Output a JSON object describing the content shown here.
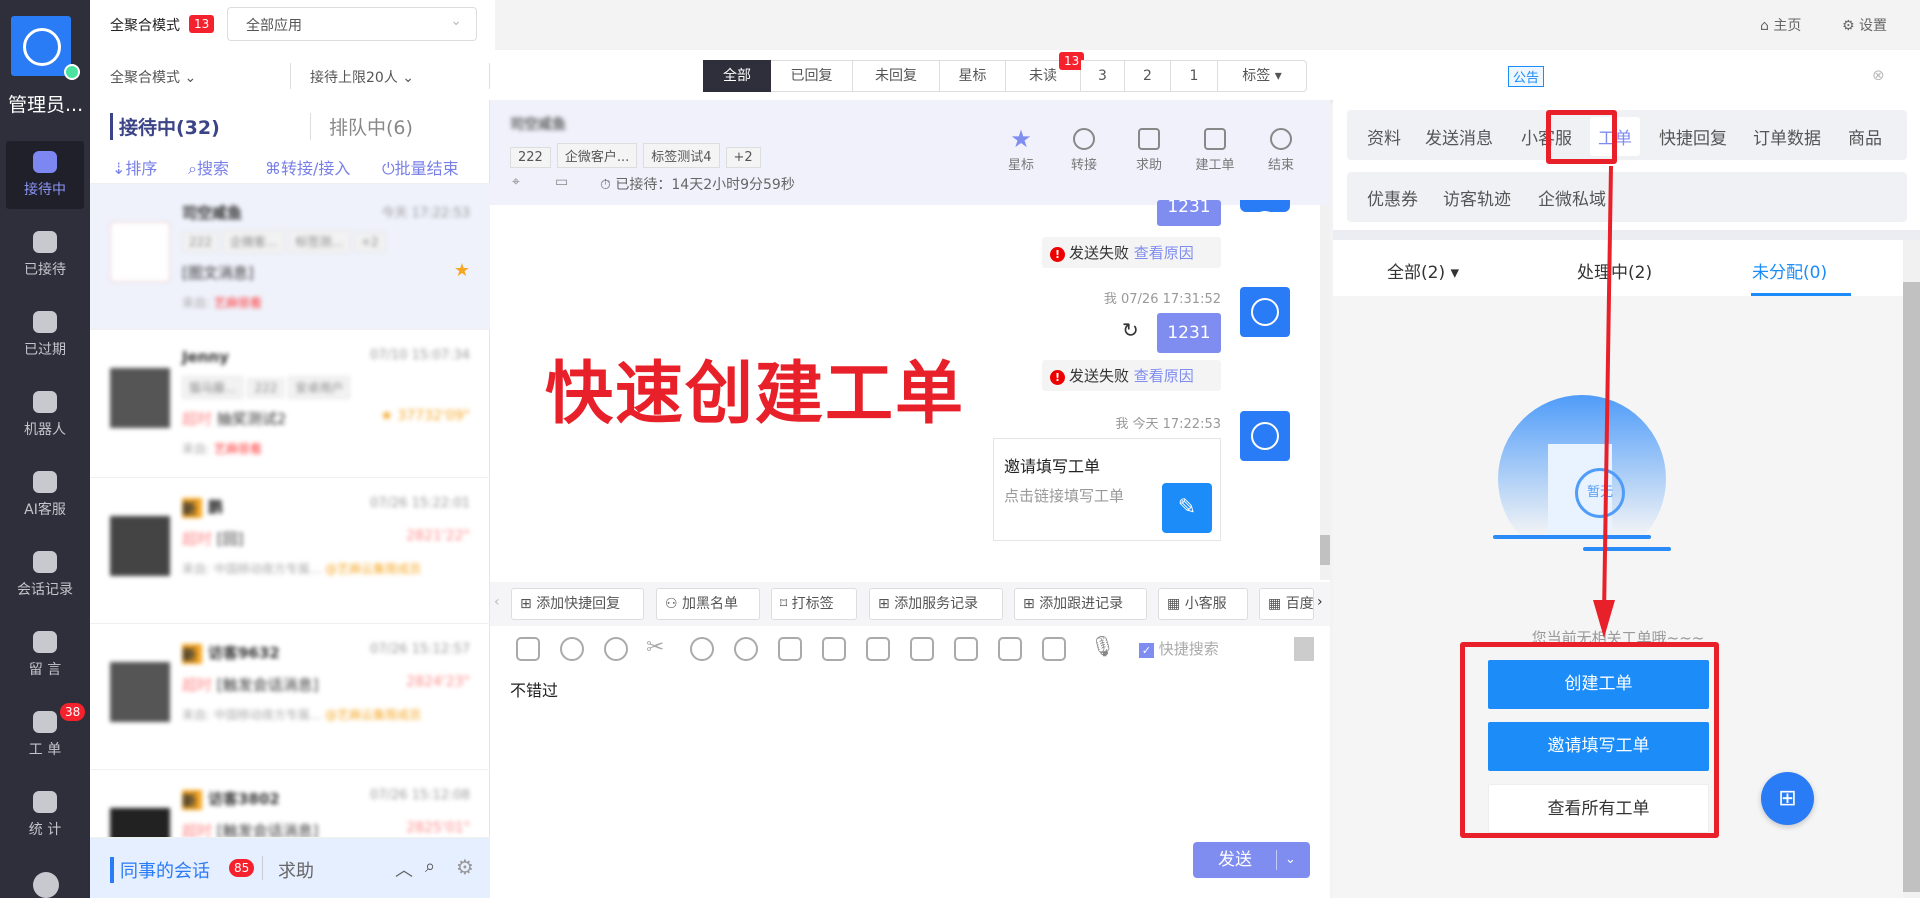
{
  "sidebar": {
    "admin": "管理员...",
    "items": [
      {
        "label": "接待中"
      },
      {
        "label": "已接待"
      },
      {
        "label": "已过期"
      },
      {
        "label": "机器人"
      },
      {
        "label": "AI客服"
      },
      {
        "label": "会话记录"
      },
      {
        "label": "留 言"
      },
      {
        "label": "工 单",
        "badge": "38"
      },
      {
        "label": "统 计"
      }
    ]
  },
  "topbar": {
    "mode": "全聚合模式",
    "mode_badge": "13",
    "app_select": "全部应用",
    "home": "主页",
    "settings": "设置"
  },
  "filterbar": {
    "mode_select": "全聚合模式",
    "limit_select": "接待上限20人",
    "tabs": [
      "全部",
      "已回复",
      "未回复",
      "星标",
      "未读",
      "3",
      "2",
      "1",
      "标签"
    ],
    "unread_badge": "13",
    "notice": "公告"
  },
  "list": {
    "tab_active": "接待中(32)",
    "tab_queue": "排队中(6)",
    "actions": [
      "排序",
      "搜索",
      "转接/接入",
      "批量结束"
    ],
    "items": [
      {
        "name": "司空咸鱼",
        "time": "今天 17:22:53",
        "tags": [
          "222",
          "企微客...",
          "标签测...",
          "+2"
        ],
        "msg": "[图文消息]",
        "from": "来自:",
        "source": "艺麻很看"
      },
      {
        "name": "Jenny",
        "time": "07/10 15:07:34",
        "tags": [
          "猫马藤...",
          "222",
          "安卓用户"
        ],
        "status": "超时",
        "msg": "抽奖测试2",
        "duration": "37732'09\"",
        "from": "来自:",
        "source": "艺麻很看"
      },
      {
        "name": "鹏",
        "new": "新",
        "time": "07/26 15:22:01",
        "status": "超时",
        "msg": "[回]",
        "duration": "2821'22\"",
        "from": "来自: 中国移动夜方专属...",
        "source": "@艺麻云集限成员"
      },
      {
        "name": "访客9632",
        "new": "新",
        "time": "07/26 15:12:57",
        "status": "超时",
        "msg": "[触发会话消息]",
        "duration": "2824'23\"",
        "from": "来自: 中国移动夜方专属...",
        "source": "@艺麻云集限成员"
      },
      {
        "name": "访客3802",
        "new": "新",
        "time": "07/26 15:12:08",
        "status": "超时",
        "msg": "[触发会话消息]",
        "duration": "2825'01\""
      }
    ],
    "bottom": {
      "colleague": "同事的会话",
      "colleague_badge": "85",
      "help": "求助"
    }
  },
  "chat": {
    "name": "司空咸鱼",
    "tags": [
      "222",
      "企微客户...",
      "标签测试4",
      "+2"
    ],
    "waited": "已接待：14天2小时9分59秒",
    "actions": [
      "星标",
      "转接",
      "求助",
      "建工单",
      "结束"
    ],
    "messages": [
      {
        "text": "1231",
        "fail": "发送失败",
        "reason": "查看原因"
      },
      {
        "meta": "我  07/26 17:31:52",
        "text": "1231",
        "fail": "发送失败",
        "reason": "查看原因"
      },
      {
        "meta": "我  今天 17:22:53",
        "card_title": "邀请填写工单",
        "card_desc": "点击链接填写工单"
      }
    ],
    "annotation": "快速创建工单",
    "quick": [
      "添加快捷回复",
      "加黑名单",
      "打标签",
      "添加服务记录",
      "添加跟进记录",
      "小客服",
      "百度"
    ],
    "quick_search": "快捷搜索",
    "input": "不错过",
    "send": "发送"
  },
  "right": {
    "tabs1": [
      "资料",
      "发送消息",
      "小客服",
      "工单",
      "快捷回复",
      "订单数据",
      "商品"
    ],
    "tabs2": [
      "优惠券",
      "访客轨迹",
      "企微私域"
    ],
    "subtabs": [
      "全部(2) ▾",
      "处理中(2)",
      "未分配(0)"
    ],
    "empty_badge": "暂无",
    "empty": "您当前无相关工单哦~~~",
    "buttons": [
      "创建工单",
      "邀请填写工单",
      "查看所有工单"
    ]
  },
  "colors": {
    "accent": "#1b8cf8",
    "annotation": "#e8202a",
    "sidebar": "#2e2f3a",
    "bubble": "#7f8cf0"
  }
}
